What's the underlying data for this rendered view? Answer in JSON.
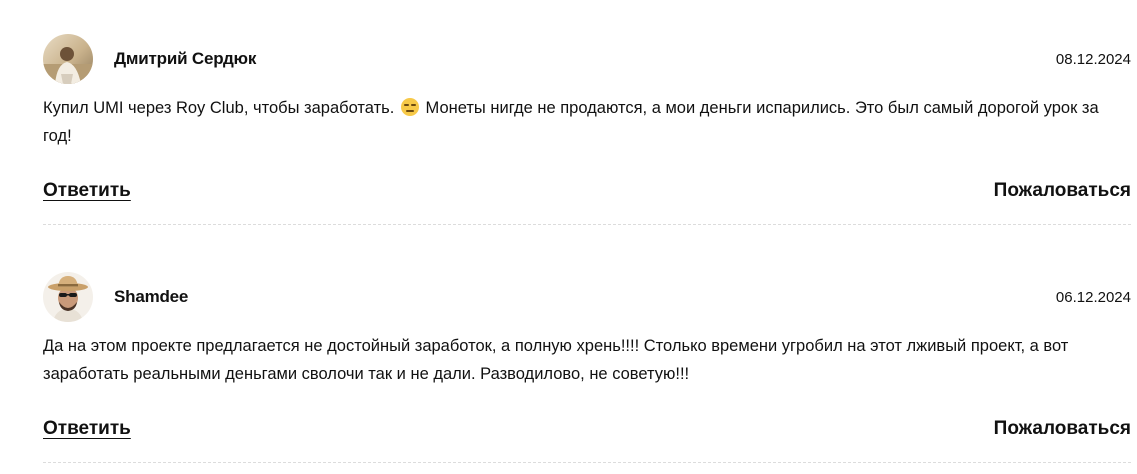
{
  "comments": [
    {
      "author": "Дмитрий Сердюк",
      "date": "08.12.2024",
      "text_before_emoji": "Купил UMI через Roy Club, чтобы заработать.",
      "emoji": "expressionless-face-emoji",
      "text_after_emoji": "Монеты нигде не продаются, а мои деньги испарились. Это был самый дорогой урок за год!",
      "reply_label": "Ответить",
      "report_label": "Пожаловаться"
    },
    {
      "author": "Shamdee",
      "date": "06.12.2024",
      "text": "Да на этом проекте предлагается не достойный заработок, а полную хрень!!!! Столько времени угробил на этот лживый проект, а вот заработать реальными деньгами сволочи так и не дали. Разводилово, не советую!!!",
      "reply_label": "Ответить",
      "report_label": "Пожаловаться"
    }
  ],
  "colors": {
    "text": "#111111",
    "divider": "#dcdcdc",
    "background": "#ffffff"
  }
}
